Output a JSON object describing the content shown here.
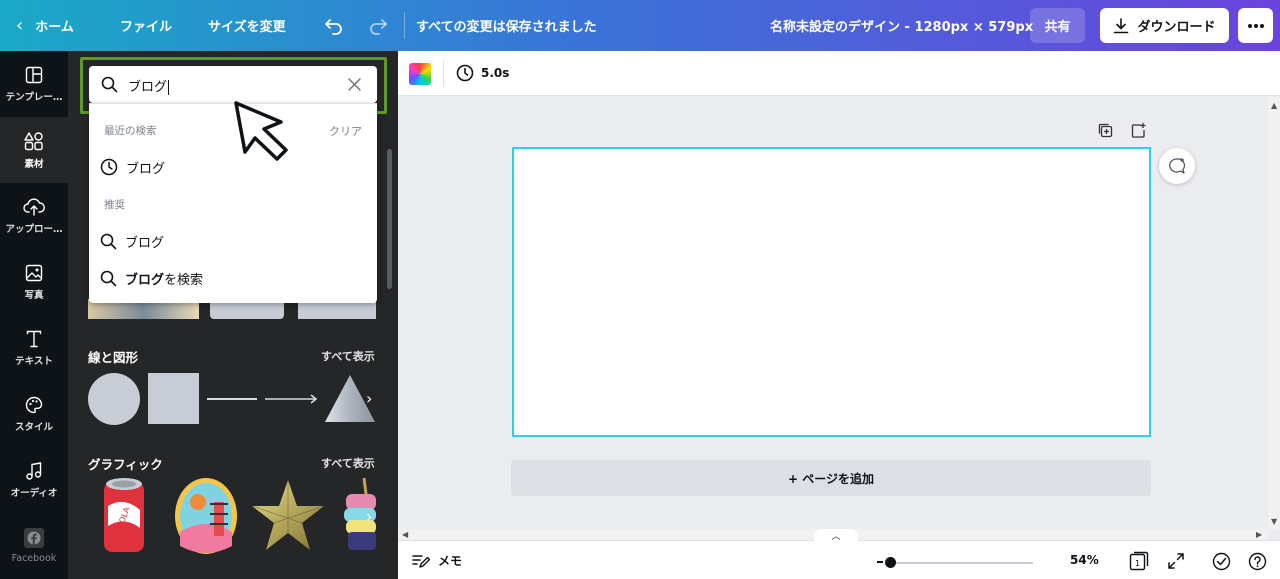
{
  "topbar": {
    "home": "ホーム",
    "file": "ファイル",
    "resize": "サイズを変更",
    "saved_status": "すべての変更は保存されました",
    "design_title": "名称未設定のデザイン - 1280px × 579px",
    "share": "共有",
    "download": "ダウンロード"
  },
  "rail": [
    {
      "label": "テンプレー…",
      "icon": "template-icon"
    },
    {
      "label": "素材",
      "icon": "elements-icon"
    },
    {
      "label": "アップロー…",
      "icon": "upload-icon"
    },
    {
      "label": "写真",
      "icon": "photo-icon"
    },
    {
      "label": "テキスト",
      "icon": "text-icon"
    },
    {
      "label": "スタイル",
      "icon": "palette-icon"
    },
    {
      "label": "オーディオ",
      "icon": "music-icon"
    },
    {
      "label": "Facebook",
      "icon": "facebook-icon"
    }
  ],
  "search": {
    "query": "ブログ",
    "recent_header": "最近の検索",
    "clear": "クリア",
    "recent_items": [
      "ブログ"
    ],
    "suggest_header": "推奨",
    "suggest_items": [
      "ブログ"
    ],
    "search_for_bold": "ブログ",
    "search_for_suffix": "を検索"
  },
  "sections": {
    "lines_shapes": "線と図形",
    "graphics": "グラフィック",
    "see_all": "すべて表示"
  },
  "context_bar": {
    "duration": "5.0s"
  },
  "canvas": {
    "add_page": "+ ページを追加"
  },
  "footer": {
    "notes": "メモ",
    "zoom": "54%",
    "page_count": "1"
  },
  "colors": {
    "accent_outline": "#5f9a26",
    "page_border": "#2fd0e0",
    "panel_bg": "#252627",
    "rail_bg": "#0e1318"
  }
}
